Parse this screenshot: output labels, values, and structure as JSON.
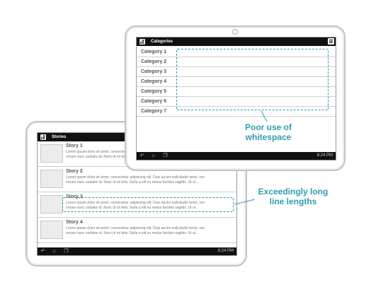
{
  "front_tablet": {
    "title": "Categories",
    "categories": [
      "Category 1",
      "Category 2",
      "Category 3",
      "Category 4",
      "Category 5",
      "Category 6",
      "Category 7"
    ],
    "clock": "8:24 PM"
  },
  "back_tablet": {
    "title": "Stories",
    "stories": [
      {
        "title": "Story 1",
        "line1": "Lorem ipsum dolor sit amet, consectetur adipiscing elit. Duis auctor sollicitudin tortor, nec",
        "line2": "ornare nunc sodales id. Nunc id mi felis. Nulla a elit eu metus facilisis sagittis. Ut ul..."
      },
      {
        "title": "Story 2",
        "line1": "Lorem ipsum dolor sit amet, consectetur adipiscing elit. Duis auctor sollicitudin tortor, nec",
        "line2": "ornare nunc sodales id. Nunc id mi felis. Nulla a elit eu metus facilisis sagittis. Ut ul..."
      },
      {
        "title": "Story 3",
        "line1": "Lorem ipsum dolor sit amet, consectetur adipiscing elit. Duis auctor sollicitudin tortor, nec",
        "line2": "ornare nunc sodales id. Nunc id mi felis. Nulla a elit eu metus facilisis sagittis. Ut ul..."
      },
      {
        "title": "Story 4",
        "line1": "Lorem ipsum dolor sit amet, consectetur adipiscing elit. Duis auctor sollicitudin tortor, nec",
        "line2": "ornare nunc sodales id. Nunc id mi felis. Nulla a elit eu metus facilisis sagittis. Ut ul..."
      }
    ],
    "clock": "8:24 PM"
  },
  "annotations": {
    "whitespace_line1": "Poor use of",
    "whitespace_line2": "whitespace",
    "line_length_line1": "Exceedingly long",
    "line_length_line2": "line lengths"
  },
  "colors": {
    "accent": "#2d9db1",
    "bar": "#111111"
  }
}
